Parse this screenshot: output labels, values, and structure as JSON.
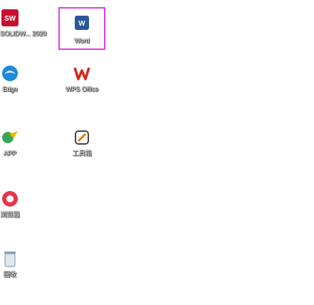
{
  "desktop": {
    "background": "#ffffff",
    "selection_color": "#e040e6",
    "icons": [
      {
        "id": "solidworks",
        "label": "SOLIDW... 2020",
        "icon": "solidworks-icon",
        "selected": false
      },
      {
        "id": "word",
        "label": "Word",
        "icon": "word-icon",
        "selected": true
      },
      {
        "id": "edge",
        "label": "Edge",
        "icon": "browser-icon",
        "selected": false
      },
      {
        "id": "wps",
        "label": "WPS Office",
        "icon": "wps-office-icon",
        "selected": false
      },
      {
        "id": "app5",
        "label": "APP",
        "icon": "bird-icon",
        "selected": false
      },
      {
        "id": "app6",
        "label": "工具箱",
        "icon": "tool-icon",
        "selected": false
      },
      {
        "id": "app7",
        "label": "浏览器",
        "icon": "circle-browser-icon",
        "selected": false
      },
      {
        "id": "recycle",
        "label": "回收",
        "icon": "recycle-bin-icon",
        "selected": false
      }
    ]
  }
}
